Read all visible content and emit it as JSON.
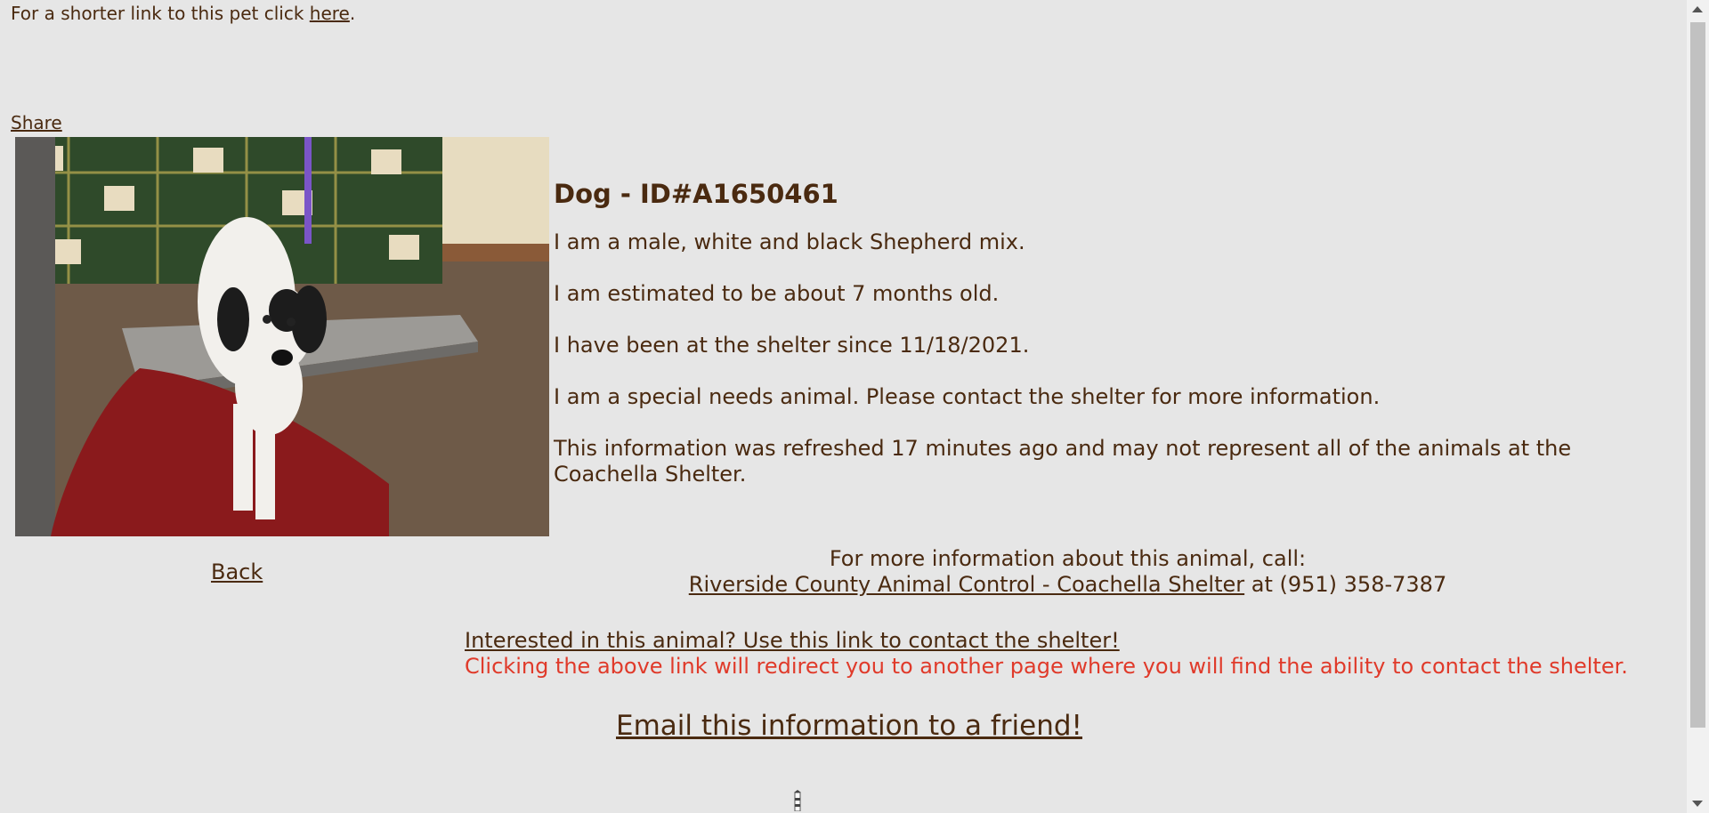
{
  "short_link": {
    "prefix": "For a shorter link to this pet click ",
    "link": "here",
    "suffix": "."
  },
  "share_label": "Share",
  "back_label": "Back",
  "animal": {
    "title": "Dog - ID#A1650461",
    "lines": [
      "I am a male, white and black Shepherd mix.",
      "I am estimated to be about 7 months old.",
      "I have been at the shelter since 11/18/2021.",
      "I am a special needs animal. Please contact the shelter for more information.",
      "This information was refreshed 17 minutes ago and may not represent all of the animals at the Coachella Shelter."
    ]
  },
  "contact": {
    "intro": "For more information about this animal, call:",
    "shelter_link": "Riverside County Animal Control - Coachella Shelter",
    "phone": " at (951) 358-7387"
  },
  "interest": {
    "link": "Interested in this animal? Use this link to contact the shelter!",
    "warning": "Clicking the above link will redirect you to another page where you will find the ability to contact the shelter."
  },
  "email_label": "Email this information to a friend!",
  "colors": {
    "text": "#4a2a10",
    "background": "#e6e6e6",
    "warning": "#e03a2a"
  }
}
